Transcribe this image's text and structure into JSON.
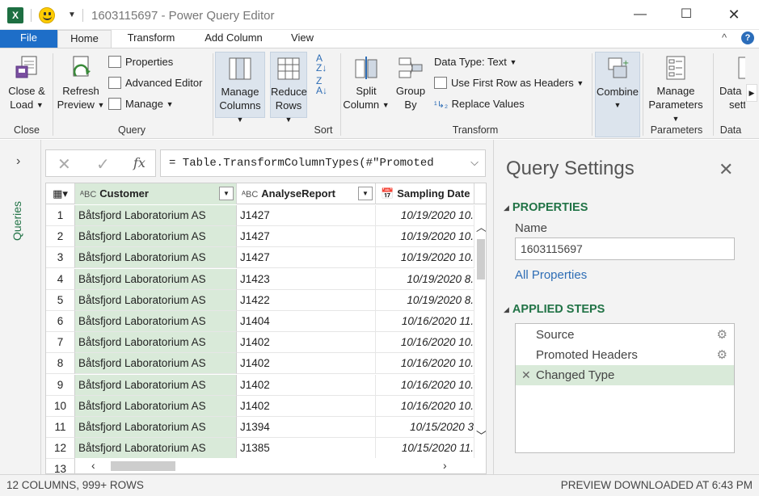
{
  "window": {
    "title": "1603115697 - Power Query Editor"
  },
  "tabs": [
    {
      "label": "File"
    },
    {
      "label": "Home"
    },
    {
      "label": "Transform"
    },
    {
      "label": "Add Column"
    },
    {
      "label": "View"
    }
  ],
  "ribbon": {
    "close_load": "Close &",
    "close_load2": "Load",
    "refresh": "Refresh",
    "refresh2": "Preview",
    "properties": "Properties",
    "advanced_editor": "Advanced Editor",
    "manage": "Manage",
    "manage_columns": "Manage",
    "manage_columns2": "Columns",
    "reduce_rows": "Reduce",
    "reduce_rows2": "Rows",
    "split_column": "Split",
    "split_column2": "Column",
    "group_by": "Group",
    "group_by2": "By",
    "data_type": "Data Type: Text",
    "use_first_row": "Use First Row as Headers",
    "replace_values": "Replace Values",
    "combine": "Combine",
    "manage_params": "Manage",
    "manage_params2": "Parameters",
    "data_source": "Data",
    "data_source2": "setti",
    "groups": {
      "close": "Close",
      "query": "Query",
      "sort": "Sort",
      "transform": "Transform",
      "parameters": "Parameters",
      "data": "Data"
    }
  },
  "queries_pane": {
    "label": "Queries"
  },
  "formula": {
    "text": "= Table.TransformColumnTypes(#\"Promoted"
  },
  "grid": {
    "columns": [
      {
        "type": "ABC",
        "name": "Customer"
      },
      {
        "type": "ABC",
        "name": "AnalyseReport"
      },
      {
        "type": "date",
        "name": "Sampling Date"
      }
    ],
    "rows": [
      {
        "n": "1",
        "customer": "Båtsfjord Laboratorium AS",
        "report": "J1427",
        "date": "10/19/2020 10."
      },
      {
        "n": "2",
        "customer": "Båtsfjord Laboratorium AS",
        "report": "J1427",
        "date": "10/19/2020 10."
      },
      {
        "n": "3",
        "customer": "Båtsfjord Laboratorium AS",
        "report": "J1427",
        "date": "10/19/2020 10."
      },
      {
        "n": "4",
        "customer": "Båtsfjord Laboratorium AS",
        "report": "J1423",
        "date": "10/19/2020 8."
      },
      {
        "n": "5",
        "customer": "Båtsfjord Laboratorium AS",
        "report": "J1422",
        "date": "10/19/2020 8."
      },
      {
        "n": "6",
        "customer": "Båtsfjord Laboratorium AS",
        "report": "J1404",
        "date": "10/16/2020 11."
      },
      {
        "n": "7",
        "customer": "Båtsfjord Laboratorium AS",
        "report": "J1402",
        "date": "10/16/2020 10."
      },
      {
        "n": "8",
        "customer": "Båtsfjord Laboratorium AS",
        "report": "J1402",
        "date": "10/16/2020 10."
      },
      {
        "n": "9",
        "customer": "Båtsfjord Laboratorium AS",
        "report": "J1402",
        "date": "10/16/2020 10."
      },
      {
        "n": "10",
        "customer": "Båtsfjord Laboratorium AS",
        "report": "J1402",
        "date": "10/16/2020 10."
      },
      {
        "n": "11",
        "customer": "Båtsfjord Laboratorium AS",
        "report": "J1394",
        "date": "10/15/2020 3"
      },
      {
        "n": "12",
        "customer": "Båtsfjord Laboratorium AS",
        "report": "J1385",
        "date": "10/15/2020 11."
      },
      {
        "n": "13",
        "customer": "",
        "report": "",
        "date": ""
      }
    ]
  },
  "query_settings": {
    "title": "Query Settings",
    "properties_header": "PROPERTIES",
    "name_label": "Name",
    "name_value": "1603115697",
    "all_properties": "All Properties",
    "applied_steps_header": "APPLIED STEPS",
    "steps": [
      {
        "label": "Source",
        "active": false
      },
      {
        "label": "Promoted Headers",
        "active": false
      },
      {
        "label": "Changed Type",
        "active": true
      }
    ]
  },
  "status": {
    "left": "12 COLUMNS, 999+ ROWS",
    "right": "PREVIEW DOWNLOADED AT 6:43 PM"
  },
  "colors": {
    "accent_green": "#217346",
    "file_tab": "#1e6ec8",
    "selected_column": "#d9ead9",
    "link": "#2e6db5"
  }
}
